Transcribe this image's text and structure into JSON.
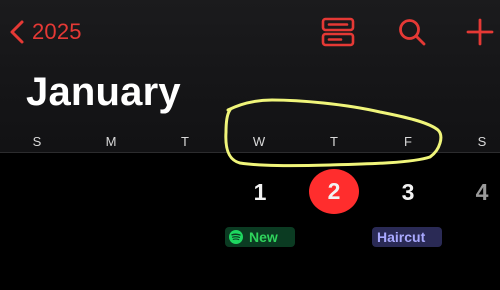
{
  "header": {
    "back_label": "2025",
    "icons": [
      "list-view-icon",
      "search-icon",
      "add-icon"
    ]
  },
  "calendar": {
    "month_title": "January",
    "weekdays": [
      "S",
      "M",
      "T",
      "W",
      "T",
      "F",
      "S"
    ],
    "days": [
      "1",
      "2",
      "3",
      "4"
    ],
    "today": "2",
    "events": [
      {
        "label": "New",
        "color": "#1ed760"
      },
      {
        "label": "Haircut",
        "color": "#a9a9ff"
      }
    ]
  },
  "colors": {
    "accent": "#e53935",
    "today_circle": "#ff2d2d",
    "annotation": "#f0f57a"
  }
}
